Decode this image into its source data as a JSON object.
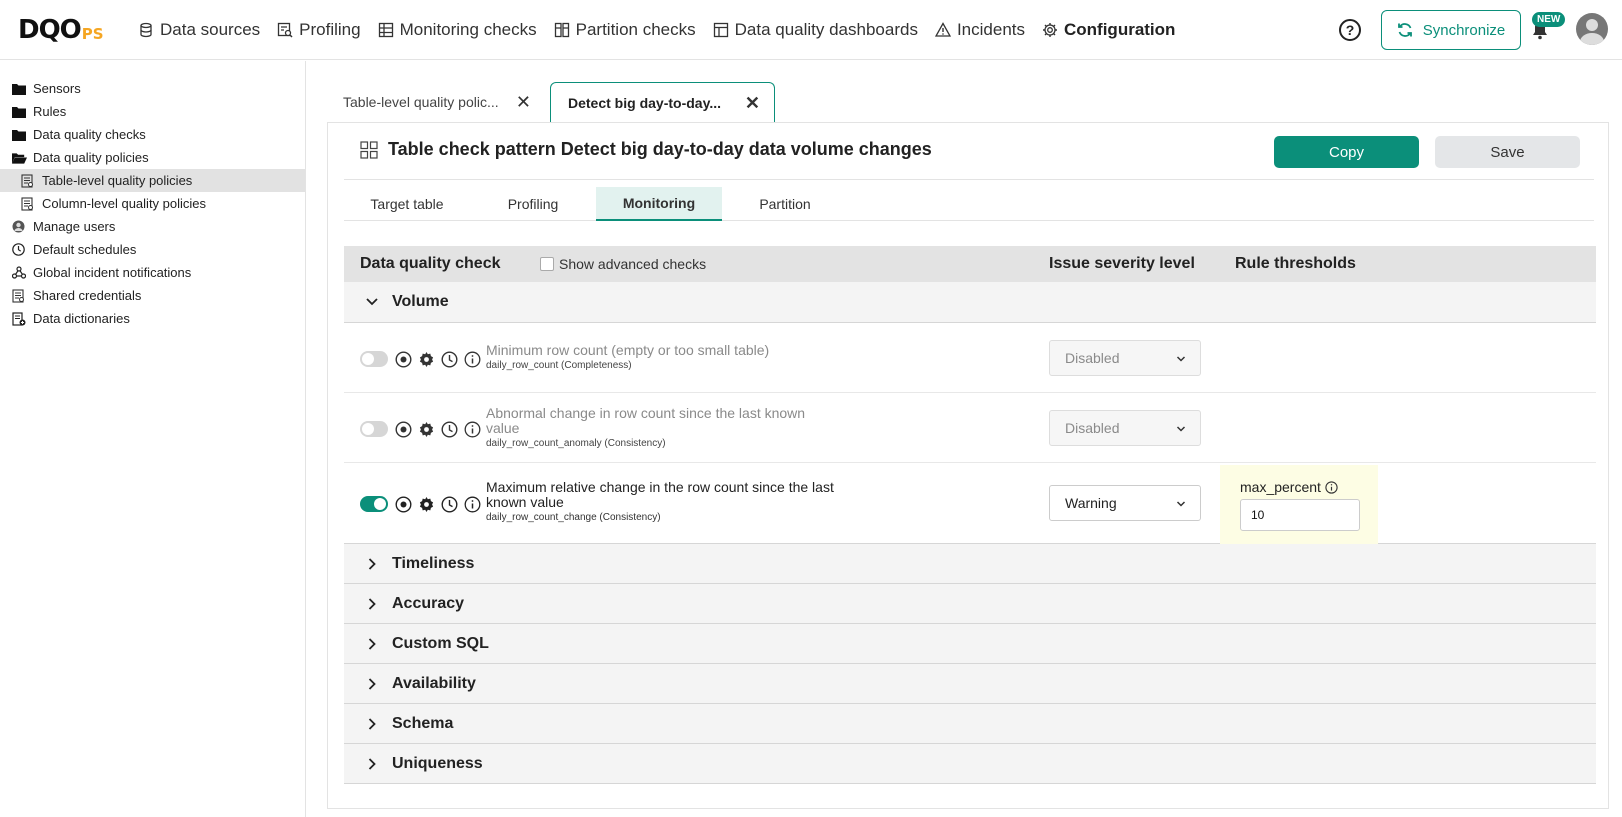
{
  "logo": {
    "main": "DQO",
    "suffix": "PS"
  },
  "nav": [
    {
      "label": "Data sources",
      "icon": "database-icon"
    },
    {
      "label": "Profiling",
      "icon": "profiling-icon"
    },
    {
      "label": "Monitoring checks",
      "icon": "monitoring-icon"
    },
    {
      "label": "Partition checks",
      "icon": "partition-icon"
    },
    {
      "label": "Data quality dashboards",
      "icon": "dashboard-icon"
    },
    {
      "label": "Incidents",
      "icon": "warning-icon"
    },
    {
      "label": "Configuration",
      "icon": "gear-icon"
    }
  ],
  "header": {
    "help": "?",
    "sync_label": "Synchronize",
    "new_badge": "NEW"
  },
  "sidebar": {
    "items": [
      {
        "label": "Sensors"
      },
      {
        "label": "Rules"
      },
      {
        "label": "Data quality checks"
      },
      {
        "label": "Data quality policies"
      },
      {
        "label": "Table-level quality policies"
      },
      {
        "label": "Column-level quality policies"
      },
      {
        "label": "Manage users"
      },
      {
        "label": "Default schedules"
      },
      {
        "label": "Global incident notifications"
      },
      {
        "label": "Shared credentials"
      },
      {
        "label": "Data dictionaries"
      }
    ]
  },
  "tabs": [
    {
      "label": "Table-level quality polic..."
    },
    {
      "label": "Detect big day-to-day..."
    }
  ],
  "panel": {
    "title": "Table check pattern Detect big day-to-day data volume changes",
    "copy_label": "Copy",
    "save_label": "Save",
    "subtabs": [
      "Target table",
      "Profiling",
      "Monitoring",
      "Partition"
    ],
    "active_subtab": "Monitoring"
  },
  "table": {
    "col_check": "Data quality check",
    "show_advanced": "Show advanced checks",
    "col_severity": "Issue severity level",
    "col_thresholds": "Rule thresholds"
  },
  "groups": {
    "volume": "Volume",
    "collapsed": [
      "Timeliness",
      "Accuracy",
      "Custom SQL",
      "Availability",
      "Schema",
      "Uniqueness"
    ]
  },
  "checks": [
    {
      "name": "Minimum row count (empty or too small table)",
      "id": "daily_row_count (Completeness)",
      "severity": "Disabled",
      "enabled": false
    },
    {
      "name": "Abnormal change in row count since the last known value",
      "id": "daily_row_count_anomaly (Consistency)",
      "severity": "Disabled",
      "enabled": false
    },
    {
      "name": "Maximum relative change in the row count since the last known value",
      "id": "daily_row_count_change (Consistency)",
      "severity": "Warning",
      "enabled": true,
      "threshold_label": "max_percent",
      "threshold_value": "10"
    }
  ],
  "colors": {
    "accent": "#0b8f7a",
    "logo_suffix": "#f5a623"
  }
}
